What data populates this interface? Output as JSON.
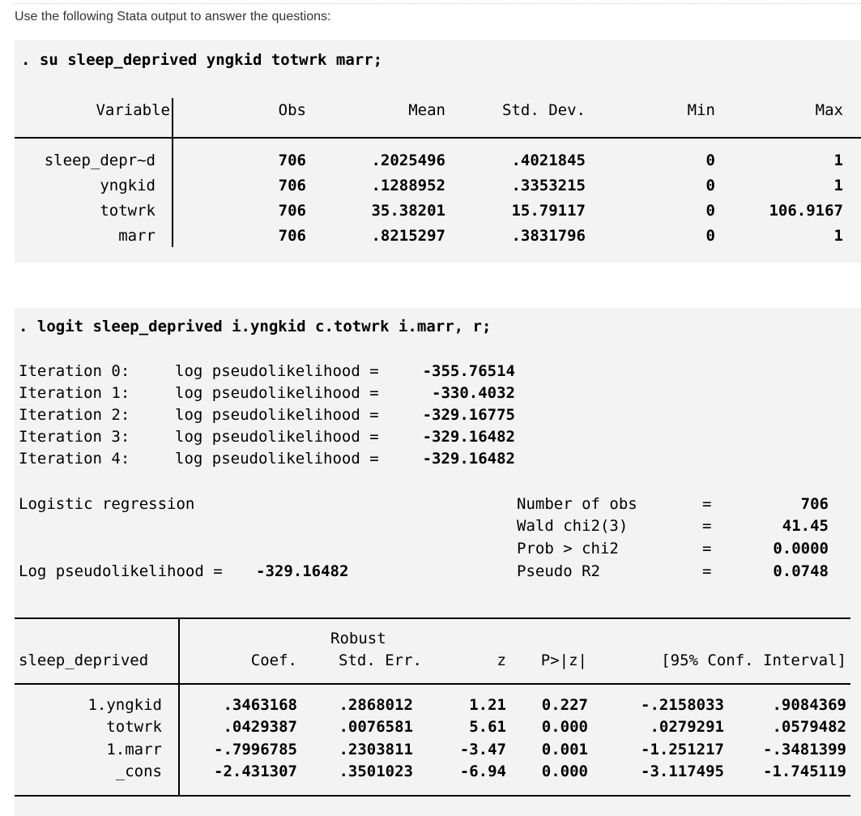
{
  "instructions": "Use the following Stata output to answer the questions:",
  "summary": {
    "command": ". su sleep_deprived yngkid totwrk marr;",
    "headers": [
      "Variable",
      "Obs",
      "Mean",
      "Std. Dev.",
      "Min",
      "Max"
    ],
    "rows": [
      [
        "sleep_depr~d",
        "706",
        ".2025496",
        ".4021845",
        "0",
        "1"
      ],
      [
        "yngkid",
        "706",
        ".1288952",
        ".3353215",
        "0",
        "1"
      ],
      [
        "totwrk",
        "706",
        "35.38201",
        "15.79117",
        "0",
        "106.9167"
      ],
      [
        "marr",
        "706",
        ".8215297",
        ".3831796",
        "0",
        "1"
      ]
    ]
  },
  "logit": {
    "command": ". logit sleep_deprived i.yngkid c.totwrk i.marr, r;",
    "iterations": [
      {
        "label": "Iteration 0:",
        "text": "log pseudolikelihood =",
        "value": "-355.76514"
      },
      {
        "label": "Iteration 1:",
        "text": "log pseudolikelihood =",
        "value": "-330.4032"
      },
      {
        "label": "Iteration 2:",
        "text": "log pseudolikelihood =",
        "value": "-329.16775"
      },
      {
        "label": "Iteration 3:",
        "text": "log pseudolikelihood =",
        "value": "-329.16482"
      },
      {
        "label": "Iteration 4:",
        "text": "log pseudolikelihood =",
        "value": "-329.16482"
      }
    ],
    "model_title": "Logistic regression",
    "stats": [
      {
        "label": "Number of obs",
        "eq": "=",
        "value": "706"
      },
      {
        "label": "Wald chi2(3)",
        "eq": "=",
        "value": "41.45"
      },
      {
        "label": "Prob > chi2",
        "eq": "=",
        "value": "0.0000"
      },
      {
        "label": "Pseudo R2",
        "eq": "=",
        "value": "0.0748"
      }
    ],
    "ll_label": "Log pseudolikelihood =",
    "ll_value": "-329.16482",
    "table": {
      "depvar": "sleep_deprived",
      "robust_label": "Robust",
      "headers": [
        "Coef.",
        "Std. Err.",
        "z",
        "P>|z|",
        "[95% Conf. Interval]"
      ],
      "rows": [
        [
          "1.yngkid",
          ".3463168",
          ".2868012",
          "1.21",
          "0.227",
          "-.2158033",
          ".9084369"
        ],
        [
          "totwrk",
          ".0429387",
          ".0076581",
          "5.61",
          "0.000",
          ".0279291",
          ".0579482"
        ],
        [
          "1.marr",
          "-.7996785",
          ".2303811",
          "-3.47",
          "0.001",
          "-1.251217",
          "-.3481399"
        ],
        [
          "_cons",
          "-2.431307",
          ".3501023",
          "-6.94",
          "0.000",
          "-3.117495",
          "-1.745119"
        ]
      ]
    }
  }
}
